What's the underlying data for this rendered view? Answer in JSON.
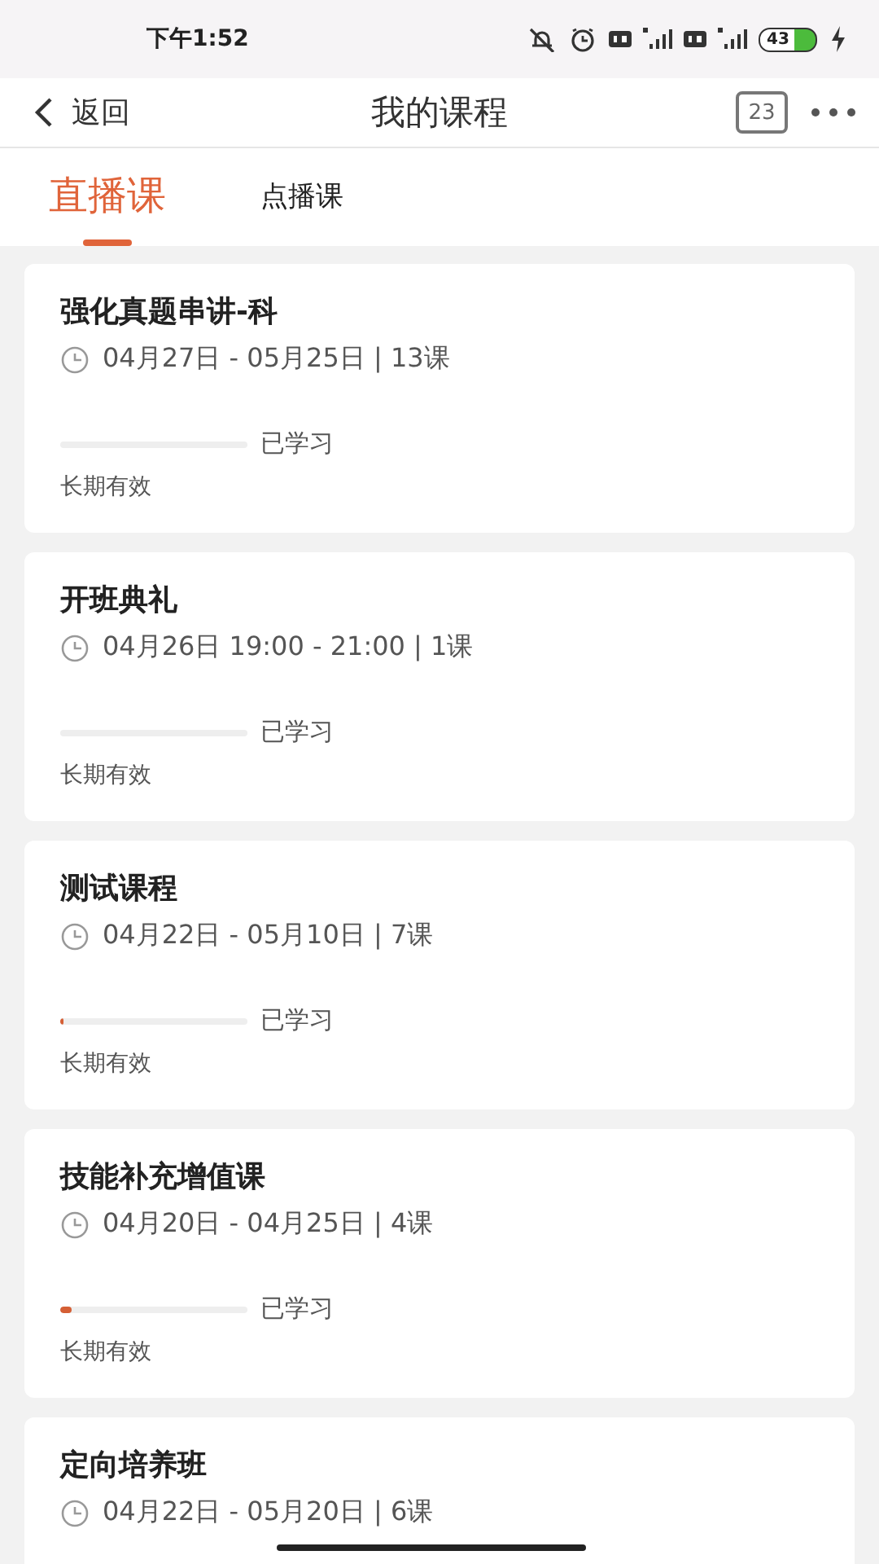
{
  "status_bar": {
    "time": "下午1:52",
    "battery": "43"
  },
  "header": {
    "back_label": "返回",
    "title": "我的课程",
    "calendar_day": "23"
  },
  "tabs": [
    {
      "label": "直播课",
      "selected": true
    },
    {
      "label": "点播课",
      "selected": false
    }
  ],
  "courses": [
    {
      "title": "强化真题串讲-科",
      "schedule": "04月27日 - 05月25日 | 13课",
      "level": 0,
      "progress_label": "已学习",
      "validity": "长期有效"
    },
    {
      "title": "开班典礼",
      "schedule": "04月26日 19:00 -  21:00 | 1课",
      "level": 0,
      "progress_label": "已学习",
      "validity": "长期有效"
    },
    {
      "title": "测试课程",
      "schedule": "04月22日 - 05月10日 | 7课",
      "level": 0.02,
      "progress_label": "已学习",
      "validity": "长期有效"
    },
    {
      "title": "技能补充增值课",
      "schedule": "04月20日 - 04月25日 | 4课",
      "level": 0.06,
      "progress_label": "已学习",
      "validity": "长期有效"
    },
    {
      "title": "定向培养班",
      "schedule": "04月22日 - 05月20日 | 6课"
    }
  ]
}
